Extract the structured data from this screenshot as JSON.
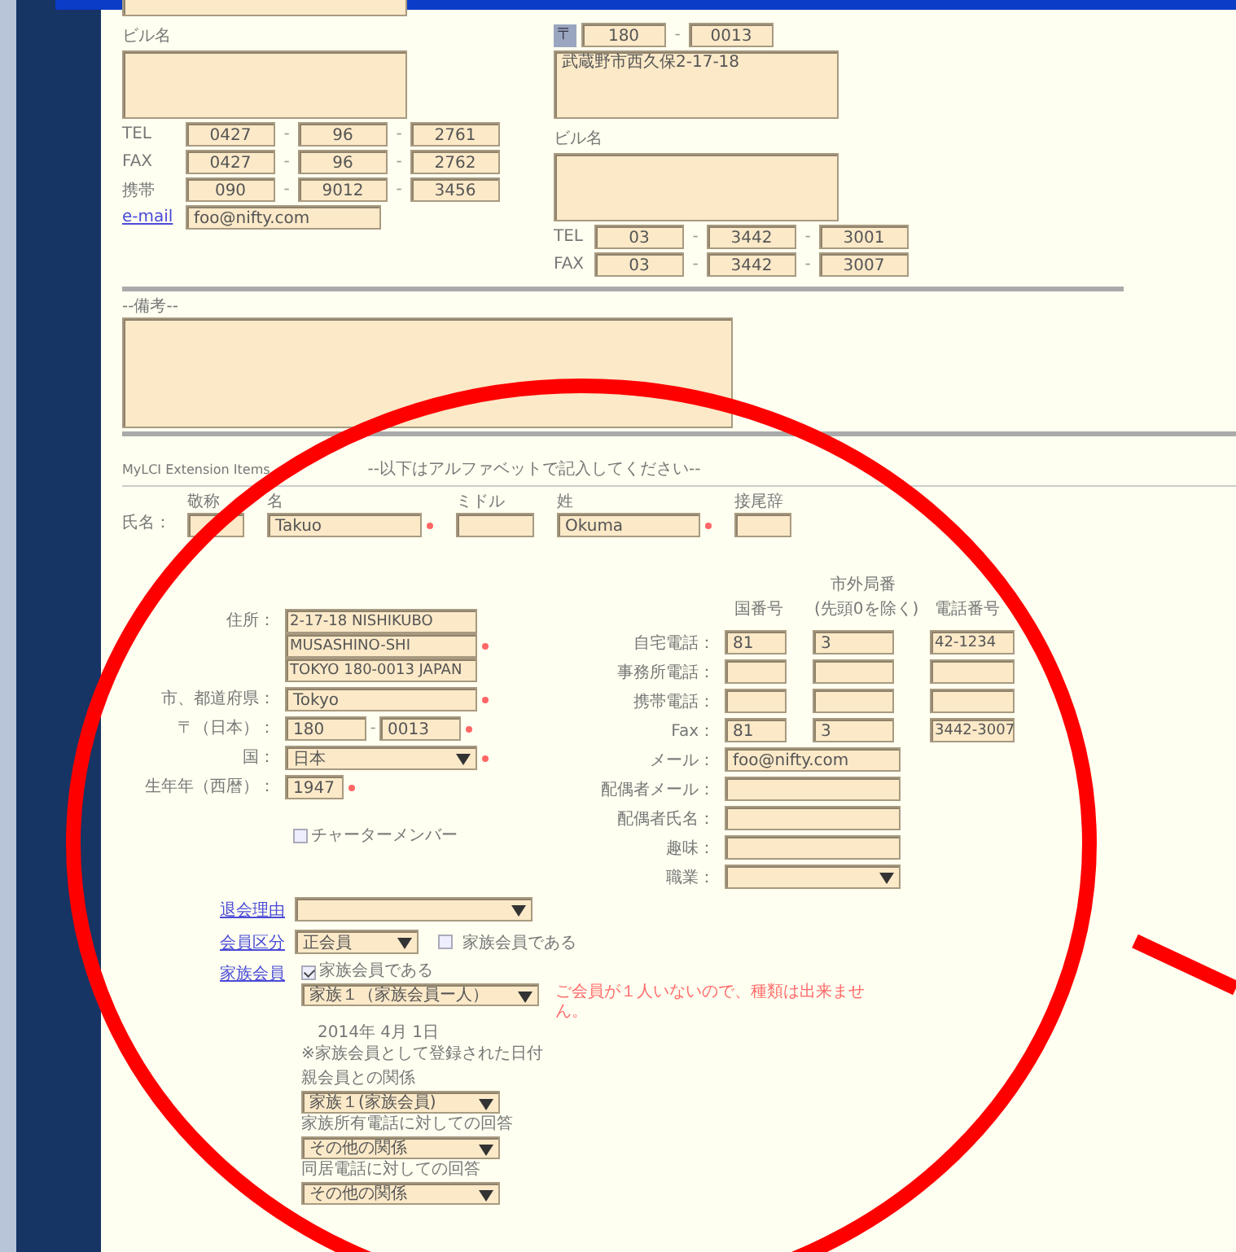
{
  "home": {
    "building_label": "ビル名",
    "separator": "-",
    "phones": [
      {
        "label": "TEL",
        "parts": [
          "0427",
          "96",
          "2761"
        ]
      },
      {
        "label": "FAX",
        "parts": [
          "0427",
          "96",
          "2762"
        ]
      },
      {
        "label": "携帯",
        "parts": [
          "090",
          "9012",
          "3456"
        ]
      }
    ],
    "email": {
      "label": "e-mail",
      "value": "foo@nifty.com"
    }
  },
  "office": {
    "separator": "-",
    "zip_label": "〒",
    "zip": [
      "180",
      "0013"
    ],
    "address": "武蔵野市西久保2-17-18",
    "building_label": "ビル名",
    "phones": [
      {
        "label": "TEL",
        "parts": [
          "03",
          "3442",
          "3001"
        ]
      },
      {
        "label": "FAX",
        "parts": [
          "03",
          "3442",
          "3007"
        ]
      }
    ]
  },
  "remarks": {
    "label": "--備考--"
  },
  "mylci": {
    "title": "MyLCI Extension Items",
    "note": "--以下はアルファベットで記入してください--"
  },
  "name": {
    "label": "氏名：",
    "columns": [
      {
        "heading": "敬称",
        "required": false
      },
      {
        "heading": "名",
        "value": "Takuo",
        "required": true
      },
      {
        "heading": "ミドル",
        "required": false
      },
      {
        "heading": "姓",
        "value": "Okuma",
        "required": true
      },
      {
        "heading": "接尾辞",
        "required": false
      }
    ]
  },
  "personal": [
    {
      "label": "住所：",
      "kind": "lines",
      "values": [
        "2-17-18 NISHIKUBO",
        "MUSASHINO-SHI",
        "TOKYO 180-0013 JAPAN"
      ],
      "required": true
    },
    {
      "label": "市、都道府県：",
      "kind": "text",
      "value": "Tokyo",
      "required": true
    },
    {
      "label": "〒（日本）：",
      "kind": "zip",
      "values": [
        "180",
        "0013"
      ],
      "separator": "-",
      "required": true
    },
    {
      "label": "国：",
      "kind": "select",
      "value": "日本",
      "required": true
    },
    {
      "label": "生年年（西暦）：",
      "kind": "short",
      "value": "1947",
      "required": true
    }
  ],
  "charter": {
    "label": "チャーターメンバー",
    "checked": false
  },
  "phone_headings": [
    "国番号",
    "市外局番\n(先頭0を除く)",
    "電話番号"
  ],
  "contacts": [
    {
      "label": "自宅電話：",
      "kind": "phone",
      "parts": [
        "81",
        "3",
        "42-1234"
      ]
    },
    {
      "label": "事務所電話：",
      "kind": "phone"
    },
    {
      "label": "携帯電話：",
      "kind": "phone"
    },
    {
      "label": "Fax：",
      "kind": "phone",
      "parts": [
        "81",
        "3",
        "3442-3007"
      ]
    },
    {
      "label": "メール：",
      "kind": "text",
      "value": "foo@nifty.com"
    },
    {
      "label": "配偶者メール：",
      "kind": "text"
    },
    {
      "label": "配偶者氏名：",
      "kind": "text"
    },
    {
      "label": "趣味：",
      "kind": "text"
    },
    {
      "label": "職業：",
      "kind": "select"
    }
  ],
  "withdraw": {
    "link": "退会理由"
  },
  "member_type": {
    "link": "会員区分",
    "value": "正会員",
    "family_label": "家族会員である",
    "family_checked": false
  },
  "family": {
    "link": "家族会員",
    "check_label": "家族会員である",
    "checked": true,
    "select": "家族１（家族会員ー人）",
    "warning": "ご会員が１人いないので、種類は出来ません。",
    "date": "2014年 4月 1日",
    "date_note": "※家族会員として登録された日付",
    "relation_label": "親会員との関係",
    "relation": "家族１(家族会員)",
    "answers": [
      {
        "note": "家族所有電話に対しての回答",
        "value": "その他の関係"
      },
      {
        "note": "同居電話に対しての回答",
        "value": "その他の関係"
      }
    ]
  }
}
